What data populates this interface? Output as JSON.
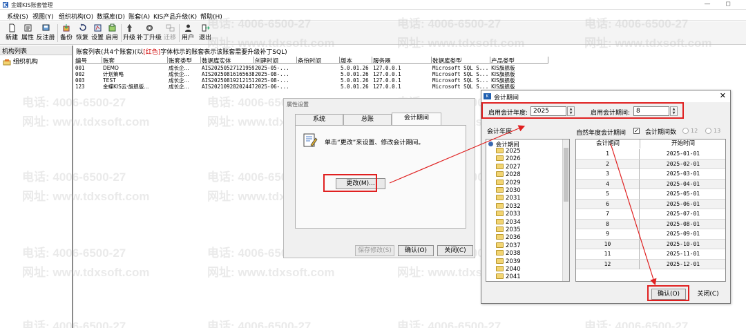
{
  "window": {
    "title": "金蝶KIS账套管理",
    "minimize": "—",
    "maximize": "◻"
  },
  "menu": [
    {
      "label": "系统(S)"
    },
    {
      "label": "视图(Y)"
    },
    {
      "label": "组织机构(O)"
    },
    {
      "label": "数据库(D)"
    },
    {
      "label": "账套(A)"
    },
    {
      "label": "KIS产品升级(K)"
    },
    {
      "label": "帮助(H)"
    }
  ],
  "toolbar": [
    {
      "label": "新建",
      "icon": "new-file-icon"
    },
    {
      "label": "属性",
      "icon": "properties-icon"
    },
    {
      "label": "反注册",
      "icon": "unregister-icon"
    },
    {
      "label": "备份",
      "icon": "backup-icon"
    },
    {
      "label": "恢复",
      "icon": "restore-icon"
    },
    {
      "label": "设置",
      "icon": "settings-icon"
    },
    {
      "label": "启用",
      "icon": "enable-icon"
    },
    {
      "label": "升级",
      "icon": "upgrade-icon"
    },
    {
      "label": "补丁升级",
      "icon": "patch-upgrade-icon"
    },
    {
      "label": "迁移",
      "icon": "migrate-icon",
      "disabled": true
    },
    {
      "label": "用户",
      "icon": "user-icon"
    },
    {
      "label": "退出",
      "icon": "exit-icon"
    }
  ],
  "left_panel": {
    "header": "机构列表",
    "root": "组织机构"
  },
  "list": {
    "caption_prefix": "账套列表(共4个账套)(以",
    "caption_red": "[红色]",
    "caption_suffix": "字体标示的账套表示该账套需要升级补丁SQL)",
    "columns": [
      "编号",
      "账套",
      "账套类型",
      "数据库实体",
      "创建时间",
      "备份时间",
      "版本",
      "服务器",
      "数据库类型",
      "产品类型"
    ],
    "rows": [
      [
        "001",
        "DEMO",
        "成长企...",
        "AIS20250527121959",
        "2025-05-...",
        "",
        "5.0.01.26",
        "127.0.0.1",
        "Microsoft SQL S...",
        "KIS旗舰版"
      ],
      [
        "002",
        "计划策略",
        "成长企...",
        "AIS20250816165638",
        "2025-08-...",
        "",
        "5.0.01.26",
        "127.0.0.1",
        "Microsoft SQL S...",
        "KIS旗舰版"
      ],
      [
        "003",
        "TEST",
        "成长企...",
        "AIS20250819212151",
        "2025-08-...",
        "",
        "5.0.01.26",
        "127.0.0.1",
        "Microsoft SQL S...",
        "KIS旗舰版"
      ],
      [
        "123",
        "金蝶KIS云·旗舰版...",
        "成长企...",
        "AIS20210928202447",
        "2025-06-...",
        "",
        "5.0.01.26",
        "127.0.0.1",
        "Microsoft SQL S...",
        "KIS旗舰版"
      ]
    ]
  },
  "watermark": {
    "phone": "电话: 4006-6500-27",
    "site": "网址: www.tdxsoft.com"
  },
  "prop_dialog": {
    "title": "属性设置",
    "tabs": [
      "系统",
      "总账",
      "会计期间"
    ],
    "info_text": "单击“更改”来设置、修改会计期间。",
    "change_button": "更改(M)...",
    "save_button": "保存修改(S)",
    "ok_button": "确认(O)",
    "close_button": "关闭(C)"
  },
  "period_dialog": {
    "title": "会计期间",
    "start_year_label": "启用会计年度:",
    "start_year_value": "2025",
    "start_period_label": "启用会计期间:",
    "start_period_value": "8",
    "year_list_label": "会计年度",
    "natural_year_label": "自然年度会计期间",
    "period_count_label": "会计期间数",
    "radio_12": "12",
    "radio_13": "13",
    "tree_root": "会计期间",
    "years": [
      "2025",
      "2026",
      "2027",
      "2028",
      "2029",
      "2030",
      "2031",
      "2032",
      "2033",
      "2034",
      "2035",
      "2036",
      "2037",
      "2038",
      "2039",
      "2040",
      "2041"
    ],
    "table_headers": [
      "会计期间",
      "开始时间"
    ],
    "periods": [
      [
        "1",
        "2025-01-01"
      ],
      [
        "2",
        "2025-02-01"
      ],
      [
        "3",
        "2025-03-01"
      ],
      [
        "4",
        "2025-04-01"
      ],
      [
        "5",
        "2025-05-01"
      ],
      [
        "6",
        "2025-06-01"
      ],
      [
        "7",
        "2025-07-01"
      ],
      [
        "8",
        "2025-08-01"
      ],
      [
        "9",
        "2025-09-01"
      ],
      [
        "10",
        "2025-10-01"
      ],
      [
        "11",
        "2025-11-01"
      ],
      [
        "12",
        "2025-12-01"
      ]
    ],
    "ok_button": "确认(O)",
    "close_button": "关闭(C)"
  },
  "colors": {
    "annotation": "#e02020",
    "folder": "#f2d472",
    "title_icon": "#1f5fb0"
  }
}
